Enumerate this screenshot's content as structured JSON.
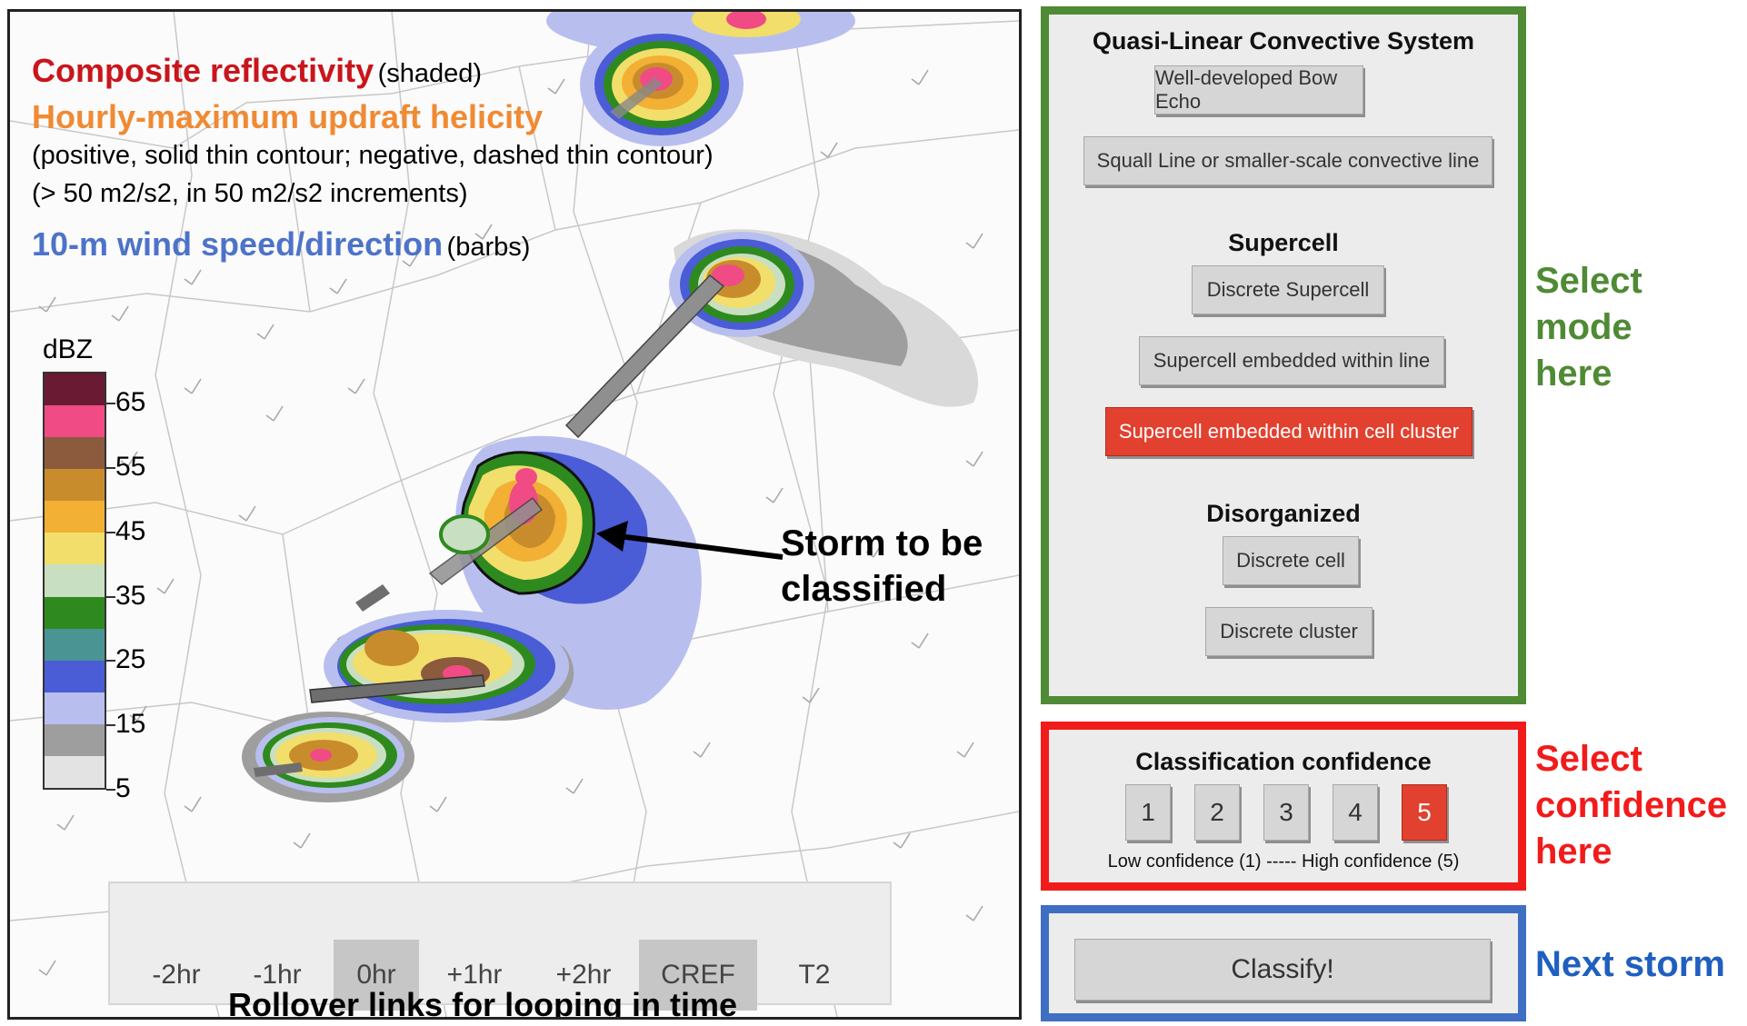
{
  "legend": {
    "cref_title": "Composite reflectivity",
    "cref_suffix": "(shaded)",
    "uh_title": "Hourly-maximum updraft helicity",
    "uh_desc_1": "(positive, solid thin contour; negative, dashed thin contour)",
    "uh_desc_2": "(> 50 m2/s2, in 50 m2/s2 increments)",
    "wind_title": "10-m wind speed/direction",
    "wind_suffix": "(barbs)",
    "colors": {
      "cref": "#c9151c",
      "uh": "#f08a33",
      "wind": "#4d73c9"
    }
  },
  "colorbar": {
    "label": "dBZ",
    "ticks": [
      "65",
      "55",
      "45",
      "35",
      "25",
      "15",
      "5"
    ],
    "colors": [
      "#6b1a33",
      "#f04b84",
      "#8c5a3c",
      "#c98c2c",
      "#f2b034",
      "#f2de6b",
      "#c9dfc2",
      "#2e8a1e",
      "#4a9494",
      "#4a5cd6",
      "#b8bfef",
      "#9e9e9e",
      "#e3e3e3"
    ]
  },
  "callout": {
    "line1": "Storm to be",
    "line2": "classified"
  },
  "time_links": {
    "items": [
      "-2hr",
      "-1hr",
      "0hr",
      "+1hr",
      "+2hr",
      "CREF",
      "T2"
    ],
    "active": [
      "0hr",
      "CREF"
    ],
    "caption": "Rollover links for looping in time"
  },
  "mode_panel": {
    "qlcs_title": "Quasi-Linear Convective System",
    "qlcs_buttons": [
      "Well-developed Bow Echo",
      "Squall Line or smaller-scale convective line"
    ],
    "supercell_title": "Supercell",
    "supercell_buttons": [
      "Discrete Supercell",
      "Supercell embedded within line",
      "Supercell embedded within cell cluster"
    ],
    "disorganized_title": "Disorganized",
    "disorganized_buttons": [
      "Discrete cell",
      "Discrete cluster"
    ],
    "selected": "Supercell embedded within cell cluster",
    "label": [
      "Select",
      "mode",
      "here"
    ],
    "color": "#4f8a34"
  },
  "confidence_panel": {
    "title": "Classification confidence",
    "options": [
      "1",
      "2",
      "3",
      "4",
      "5"
    ],
    "selected": "5",
    "scale": "Low confidence (1) ----- High confidence (5)",
    "label": [
      "Select",
      "confidence",
      "here"
    ],
    "color": "#f21b1b"
  },
  "next_panel": {
    "button": "Classify!",
    "label": "Next storm",
    "color": "#1f5fbf"
  },
  "selected_color": "#e1412e"
}
